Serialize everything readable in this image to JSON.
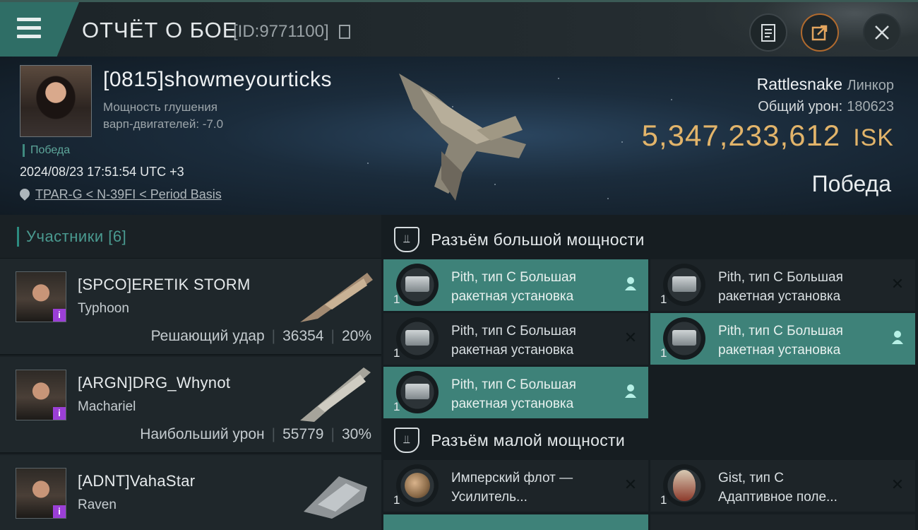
{
  "header": {
    "title": "ОТЧЁТ О БОЕ",
    "report_id": "[ID:9771100]",
    "icons": [
      "menu-icon",
      "copy-icon",
      "clipboard-icon",
      "share-icon",
      "close-icon"
    ]
  },
  "victim": {
    "name": "[0815]showmeyourticks",
    "stat_line1": "Мощность глушения",
    "stat_line2": "варп-двигателей: -7.0",
    "result_small": "Победа",
    "datetime": "2024/08/23 17:51:54 UTC +3",
    "location": "TPAR-G < N-39FI < Period Basis",
    "ship": "Rattlesnake",
    "ship_class": "Линкор",
    "damage_label": "Общий урон:",
    "damage_value": "180623",
    "isk_value": "5,347,233,612",
    "isk_currency": "ISK",
    "result_big": "Победа"
  },
  "participants": {
    "label": "Участники",
    "count": "[6]",
    "rows": [
      {
        "name": "[SPCO]ERETIK STORM",
        "ship": "Typhoon",
        "tag": "Решающий удар",
        "damage": "36354",
        "percent": "20%"
      },
      {
        "name": "[ARGN]DRG_Whynot",
        "ship": "Machariel",
        "tag": "Наибольший урон",
        "damage": "55779",
        "percent": "30%"
      },
      {
        "name": "[ADNT]VahaStar",
        "ship": "Raven",
        "tag": "",
        "damage": "",
        "percent": ""
      }
    ]
  },
  "slots": {
    "high_title": "Разъём большой мощности",
    "low_title": "Разъём малой мощности",
    "high_items": [
      {
        "qty": "1",
        "line1": "Pith, тип С Большая",
        "line2": "ракетная установка",
        "status": "dropped"
      },
      {
        "qty": "1",
        "line1": "Pith, тип С Большая",
        "line2": "ракетная установка",
        "status": "destroyed"
      },
      {
        "qty": "1",
        "line1": "Pith, тип С Большая",
        "line2": "ракетная установка",
        "status": "destroyed"
      },
      {
        "qty": "1",
        "line1": "Pith, тип С Большая",
        "line2": "ракетная установка",
        "status": "dropped"
      },
      {
        "qty": "1",
        "line1": "Pith, тип С Большая",
        "line2": "ракетная установка",
        "status": "dropped"
      }
    ],
    "low_items": [
      {
        "qty": "1",
        "line1": "Имперский флот —",
        "line2": "Усилитель...",
        "status": "destroyed"
      },
      {
        "qty": "1",
        "line1": "Gist, тип С",
        "line2": "Адаптивное поле...",
        "status": "destroyed"
      }
    ]
  },
  "colors": {
    "accent": "#3e8279",
    "isk": "#e2b46a",
    "badge": "#9b3fd6"
  }
}
